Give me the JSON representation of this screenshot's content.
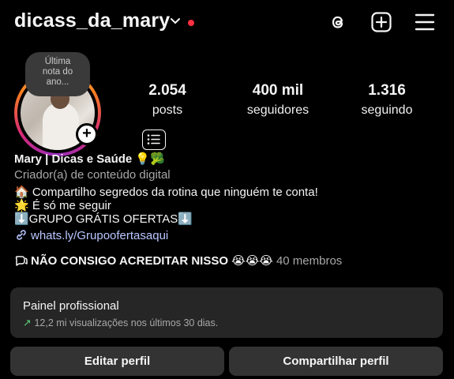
{
  "header": {
    "username": "dicass_da_mary",
    "icons": [
      "threads-icon",
      "add-icon",
      "menu-icon"
    ],
    "notification_color": "#ff3040"
  },
  "note": {
    "lines": [
      "Última",
      "nota do",
      "ano..."
    ]
  },
  "stats": [
    {
      "value": "2.054",
      "label": "posts"
    },
    {
      "value": "400 mil",
      "label": "seguidores"
    },
    {
      "value": "1.316",
      "label": "seguindo"
    }
  ],
  "bio": {
    "name": "Mary | Dicas e Saúde 💡🥦",
    "category": "Criador(a) de conteúdo digital",
    "line1": "🏠 Compartilho segredos da rotina que ninguém te conta!",
    "line2": "🌟 É só me seguir",
    "line3": "⬇️GRUPO GRÁTIS OFERTAS⬇️",
    "link": "whats.ly/Grupoofertasaqui"
  },
  "channel": {
    "title": "NÃO CONSIGO ACREDITAR NISSO 😭😭😭",
    "members": "40 membros"
  },
  "panel": {
    "title": "Painel profissional",
    "subtitle": "12,2 mi visualizações nos últimos 30 dias."
  },
  "buttons": {
    "edit": "Editar perfil",
    "share": "Compartilhar perfil"
  }
}
